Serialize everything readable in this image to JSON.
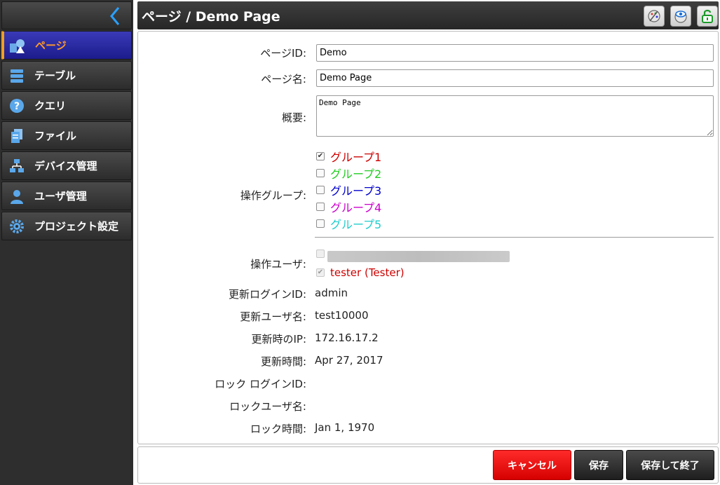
{
  "header": {
    "title": "ページ / Demo Page"
  },
  "sidebar": {
    "items": [
      {
        "label": "ページ",
        "icon": "page-icon",
        "active": true
      },
      {
        "label": "テーブル",
        "icon": "table-icon"
      },
      {
        "label": "クエリ",
        "icon": "query-icon"
      },
      {
        "label": "ファイル",
        "icon": "file-icon"
      },
      {
        "label": "デバイス管理",
        "icon": "device-icon"
      },
      {
        "label": "ユーザ管理",
        "icon": "user-icon"
      },
      {
        "label": "プロジェクト設定",
        "icon": "settings-gear-icon"
      }
    ]
  },
  "form": {
    "page_id": {
      "label": "ページID:",
      "value": "Demo"
    },
    "page_name": {
      "label": "ページ名:",
      "value": "Demo Page"
    },
    "summary": {
      "label": "概要:",
      "value": "Demo Page"
    },
    "groups": {
      "label": "操作グループ:",
      "items": [
        {
          "name": "グループ1",
          "checked": true,
          "color": "#cc0000"
        },
        {
          "name": "グループ2",
          "checked": false,
          "color": "#22cc22"
        },
        {
          "name": "グループ3",
          "checked": false,
          "color": "#0000cc"
        },
        {
          "name": "グループ4",
          "checked": false,
          "color": "#cc00cc"
        },
        {
          "name": "グループ5",
          "checked": false,
          "color": "#22cccc"
        }
      ]
    },
    "users": {
      "label": "操作ユーザ:",
      "items": [
        {
          "name": "tester (Tester)",
          "checked": true,
          "color": "#cc0000"
        }
      ]
    },
    "update_login_id": {
      "label": "更新ログインID:",
      "value": "admin"
    },
    "update_user_name": {
      "label": "更新ユーザ名:",
      "value": "test10000"
    },
    "update_ip": {
      "label": "更新時のIP:",
      "value": "172.16.17.2"
    },
    "update_time": {
      "label": "更新時間:",
      "value": "Apr 27, 2017"
    },
    "lock_login_id": {
      "label": "ロック ログインID:",
      "value": ""
    },
    "lock_user_name": {
      "label": "ロックユーザ名:",
      "value": ""
    },
    "lock_time": {
      "label": "ロック時間:",
      "value": "Jan 1, 1970"
    }
  },
  "footer": {
    "cancel_label": "キャンセル",
    "save_label": "保存",
    "save_exit_label": "保存して終了"
  },
  "colors": {
    "accent": "#1e1e8c",
    "active_text": "#ff9a2a",
    "cancel": "#ee0000"
  }
}
